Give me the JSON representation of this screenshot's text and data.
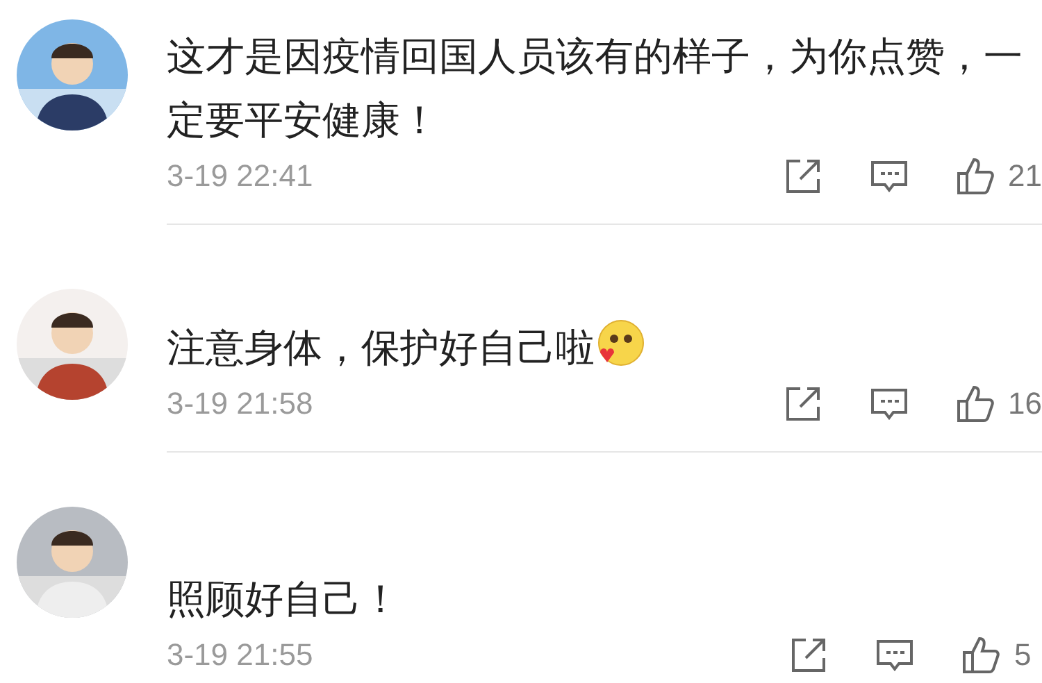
{
  "comments": [
    {
      "text": "这才是因疫情回国人员该有的样子，为你点赞，一定要平安健康！",
      "trailing_emoji": false,
      "time": "3-19 22:41",
      "likes": "21"
    },
    {
      "text": "注意身体，保护好自己啦",
      "trailing_emoji": true,
      "time": "3-19 21:58",
      "likes": "16"
    },
    {
      "text": "照顾好自己！",
      "trailing_emoji": false,
      "time": "3-19 21:55",
      "likes": "5"
    }
  ]
}
